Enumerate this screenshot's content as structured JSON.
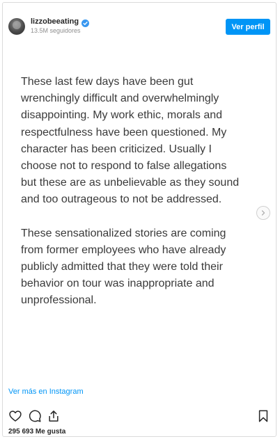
{
  "header": {
    "username": "lizzobeeating",
    "followers": "13.5M seguidores",
    "profile_button": "Ver perfil"
  },
  "post": {
    "paragraphs": [
      "These last few days have been gut\nwrenchingly difficult and overwhelmingly\ndisappointing. My work ethic, morals and\nrespectfulness have been questioned. My\ncharacter has been criticized. Usually I\nchoose not to respond to false allegations\nbut these are as unbelievable as they sound\nand too outrageous to not be addressed.",
      "These sensationalized stories are coming\nfrom former employees who have already\npublicly admitted that they were told their\nbehavior on tour was inappropriate and\nunprofessional."
    ],
    "next_icon": "chevron-right-icon"
  },
  "footer": {
    "view_more": "Ver más en Instagram",
    "likes": "295 693 Me gusta"
  },
  "icons": {
    "like": "heart-icon",
    "comment": "comment-icon",
    "share": "share-icon",
    "save": "bookmark-icon",
    "verified": "verified-badge-icon"
  },
  "colors": {
    "accent": "#0095f6",
    "text": "#262626",
    "muted": "#8e8e8e",
    "border": "#dbdbdb"
  }
}
